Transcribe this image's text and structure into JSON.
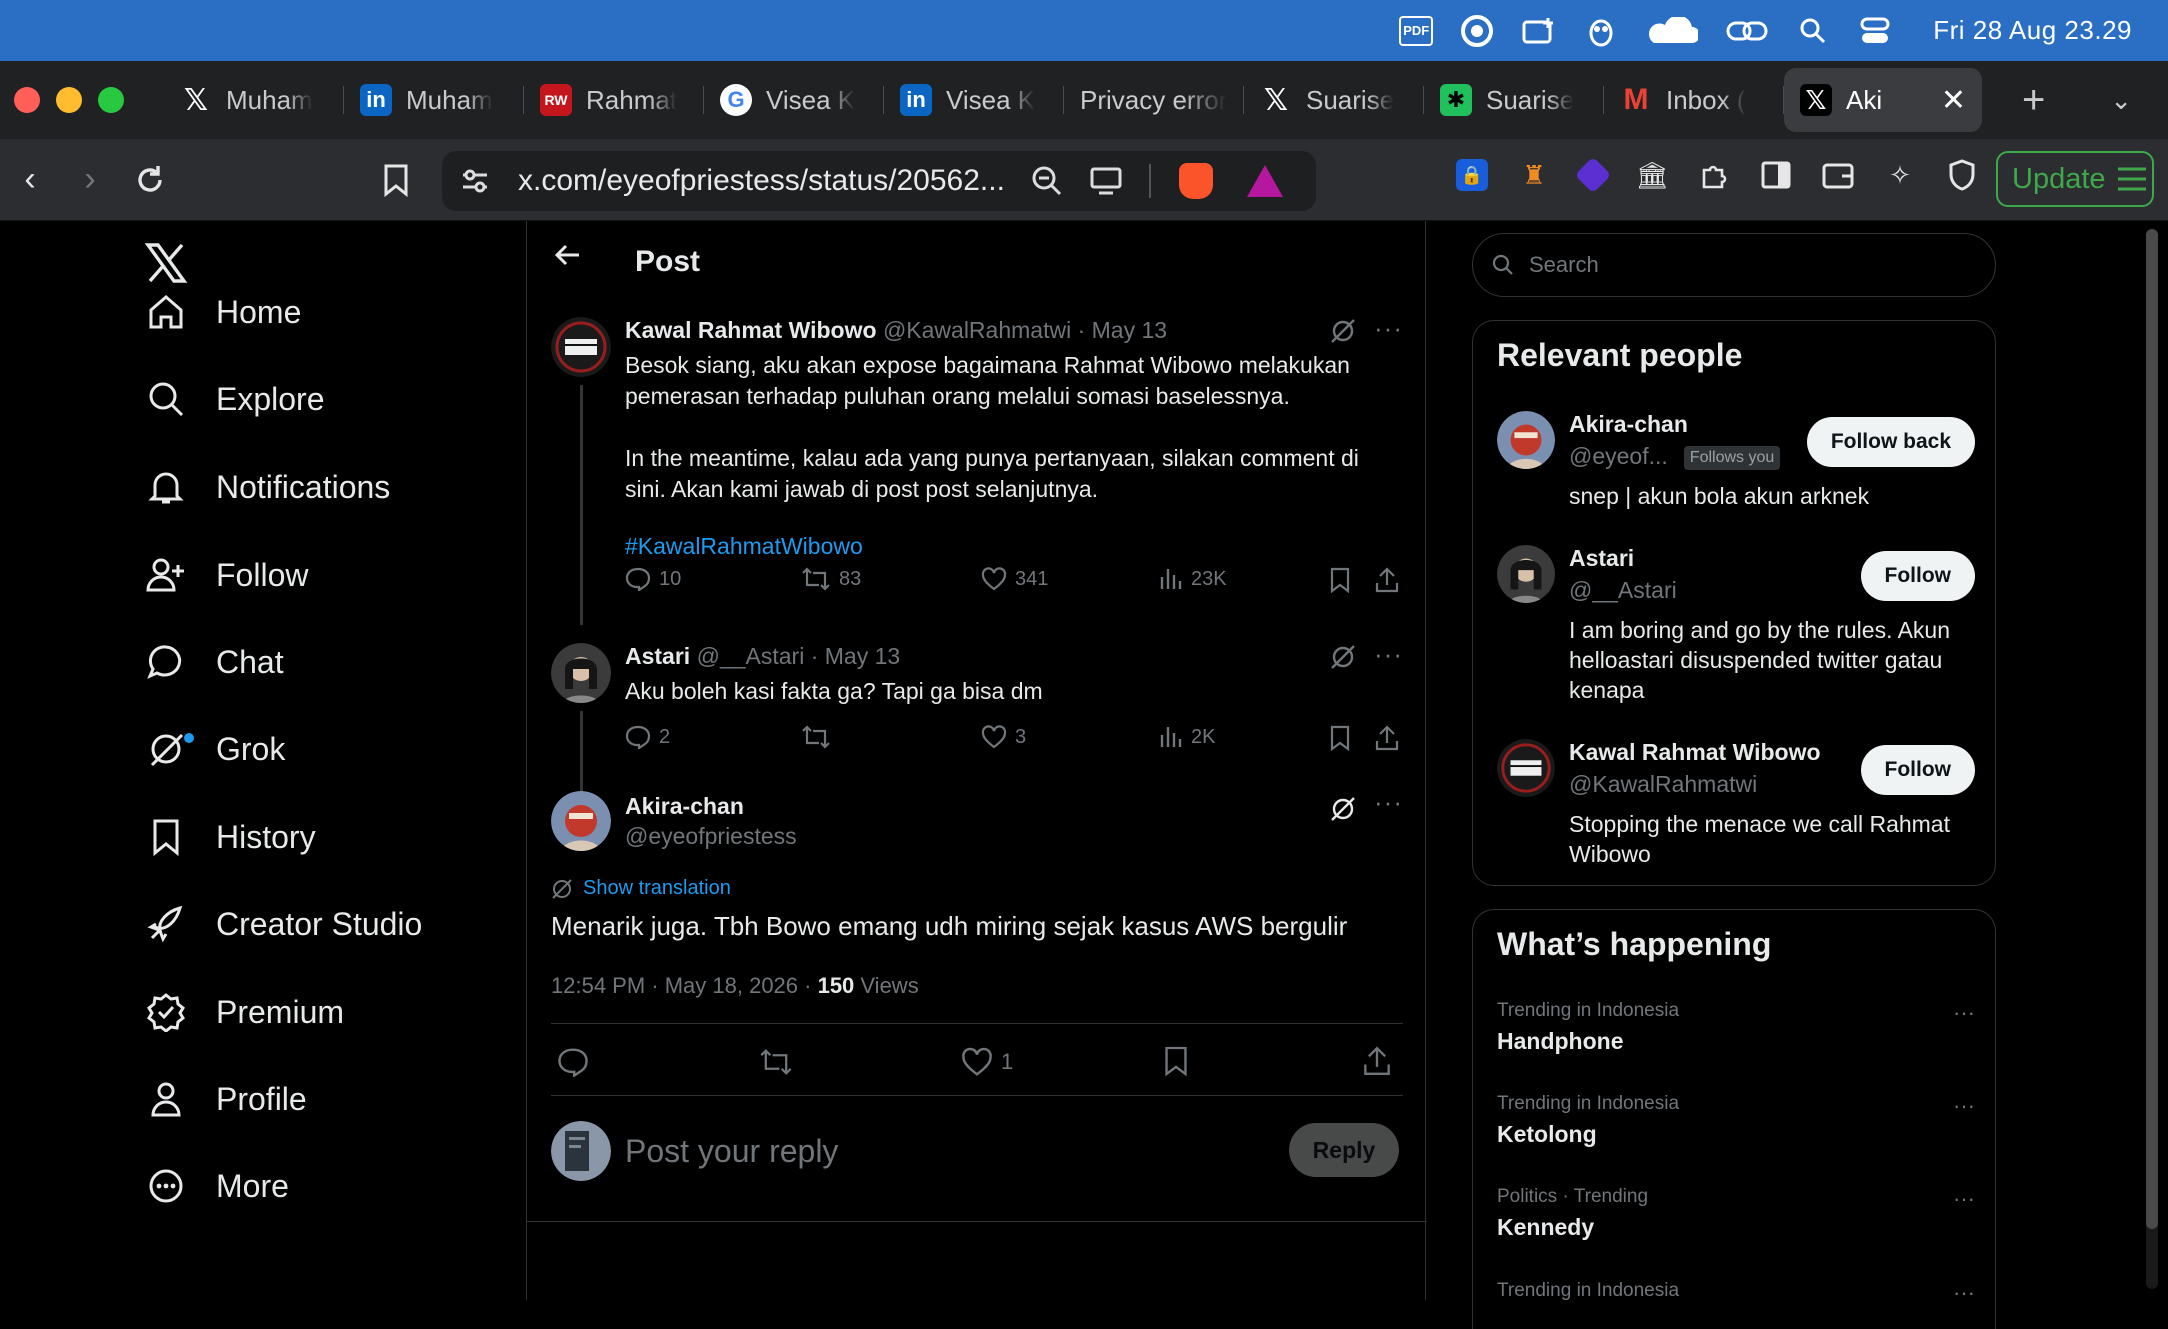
{
  "menubar": {
    "pdf_label": "PDF",
    "clock": "Fri 28 Aug  23.29"
  },
  "tabs": [
    {
      "label": "Muham",
      "icon": "x-logo-icon"
    },
    {
      "label": "Muham",
      "icon": "linkedin-icon"
    },
    {
      "label": "Rahmat",
      "icon": "rw-icon"
    },
    {
      "label": "Visea K",
      "icon": "google-icon"
    },
    {
      "label": "Visea K",
      "icon": "linkedin-icon"
    },
    {
      "label": "Privacy error",
      "icon": "none"
    },
    {
      "label": "Suarise",
      "icon": "x-logo-icon"
    },
    {
      "label": "Suarise",
      "icon": "perplexity-icon"
    },
    {
      "label": "Inbox (",
      "icon": "gmail-icon"
    },
    {
      "label": "Aki",
      "icon": "x-logo-icon",
      "active": true
    }
  ],
  "toolbar": {
    "url": "x.com/eyeofpriestess/status/20562...",
    "update_label": "Update"
  },
  "nav": {
    "items": [
      {
        "label": "Home",
        "icon": "home-icon"
      },
      {
        "label": "Explore",
        "icon": "search-icon"
      },
      {
        "label": "Notifications",
        "icon": "bell-icon"
      },
      {
        "label": "Follow",
        "icon": "add-person-icon"
      },
      {
        "label": "Chat",
        "icon": "chat-bubble-icon"
      },
      {
        "label": "Grok",
        "icon": "grok-icon"
      },
      {
        "label": "History",
        "icon": "bookmark-icon"
      },
      {
        "label": "Creator Studio",
        "icon": "rocket-icon"
      },
      {
        "label": "Premium",
        "icon": "verified-icon"
      },
      {
        "label": "Profile",
        "icon": "person-icon"
      },
      {
        "label": "More",
        "icon": "more-circle-icon"
      }
    ]
  },
  "post": {
    "title": "Post",
    "thread": [
      {
        "name": "Kawal Rahmat Wibowo",
        "handle": "@KawalRahmatwi",
        "date": "· May 13",
        "text": "Besok siang, aku akan expose bagaimana Rahmat Wibowo melakukan\npemerasan terhadap puluhan orang melalui somasi baselessnya.\n\nIn the meantime, kalau ada yang punya pertanyaan, silakan comment di\nsini. Akan kami jawab di post post selanjutnya.",
        "hashtag": "#KawalRahmatWibowo",
        "replies": "10",
        "reposts": "83",
        "likes": "341",
        "views": "23K"
      },
      {
        "name": "Astari",
        "handle": "@__Astari",
        "date": "· May 13",
        "text": "Aku boleh kasi fakta ga? Tapi ga bisa dm",
        "replies": "2",
        "reposts": "",
        "likes": "3",
        "views": "2K"
      }
    ],
    "main": {
      "name": "Akira-chan",
      "handle": "@eyeofpriestess",
      "show_translation": "Show translation",
      "text": "Menarik juga. Tbh Bowo emang udh miring sejak kasus AWS bergulir",
      "timestamp": "12:54 PM · May 18, 2026 · ",
      "views_count": "150",
      "views_label": " Views",
      "likes": "1"
    },
    "reply_placeholder": "Post your reply",
    "reply_button": "Reply"
  },
  "sidebar": {
    "search_placeholder": "Search",
    "relevant_title": "Relevant people",
    "people": [
      {
        "name": "Akira-chan",
        "handle": "@eyeof...",
        "badge": "Follows you",
        "bio": "snep | akun bola akun arknek",
        "button": "Follow back"
      },
      {
        "name": "Astari",
        "handle": "@__Astari",
        "badge": "",
        "bio": "I am boring and go by the rules. Akun helloastari disuspended twitter gatau kenapa",
        "button": "Follow"
      },
      {
        "name": "Kawal Rahmat Wibowo",
        "handle": "@KawalRahmatwi",
        "badge": "",
        "bio": "Stopping the menace we call Rahmat Wibowo",
        "button": "Follow"
      }
    ],
    "happening_title": "What’s happening",
    "trends": [
      {
        "category": "Trending in Indonesia",
        "name": "Handphone"
      },
      {
        "category": "Trending in Indonesia",
        "name": "Ketolong"
      },
      {
        "category": "Politics · Trending",
        "name": "Kennedy"
      },
      {
        "category": "Trending in Indonesia",
        "name": ""
      }
    ]
  }
}
